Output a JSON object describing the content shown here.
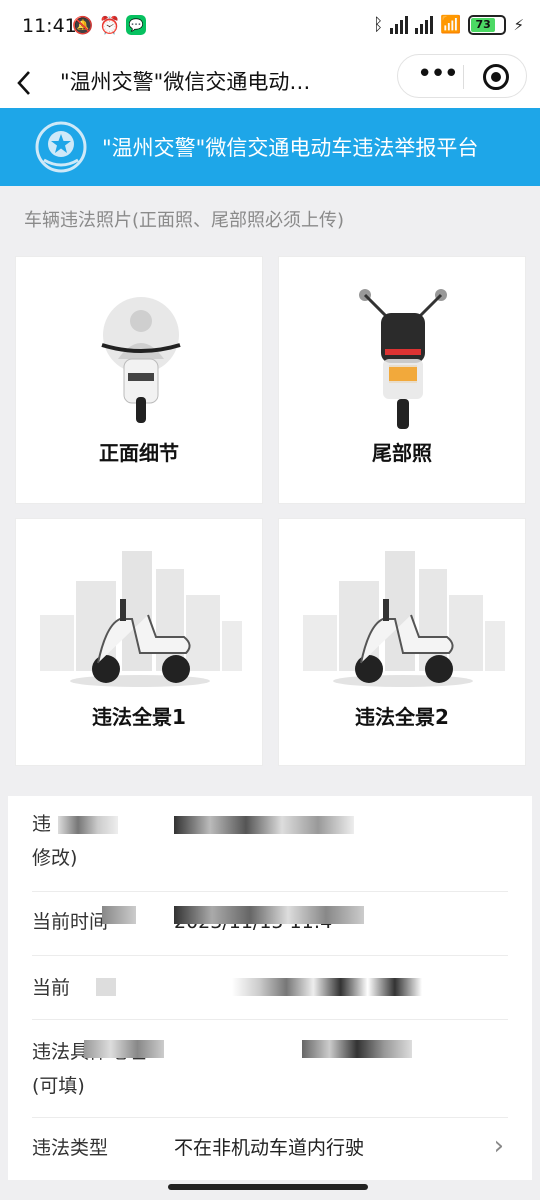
{
  "status_bar": {
    "time": "11:41",
    "battery": "73"
  },
  "nav": {
    "back_icon": "chevron-left-icon",
    "title": "\"温州交警\"微信交通电动…"
  },
  "banner": {
    "title": "\"温州交警\"微信交通电动车违法举报平台",
    "brand_color": "#1ea6e8"
  },
  "photos": {
    "section_label": "车辆违法照片(正面照、尾部照必须上传)",
    "cards": [
      {
        "label": "正面细节"
      },
      {
        "label": "尾部照"
      },
      {
        "label": "违法全景1"
      },
      {
        "label": "违法全景2"
      }
    ]
  },
  "form": {
    "rows": [
      {
        "label": "违",
        "label2": "修改)",
        "value": ""
      },
      {
        "label": "当前时间",
        "value": "2023/11/15  11:4"
      },
      {
        "label": "当前",
        "value": ""
      },
      {
        "label": "违法具体地址",
        "label2": "(可填)",
        "value": ""
      },
      {
        "label": "违法类型",
        "value": "不在非机动车道内行驶"
      }
    ]
  }
}
